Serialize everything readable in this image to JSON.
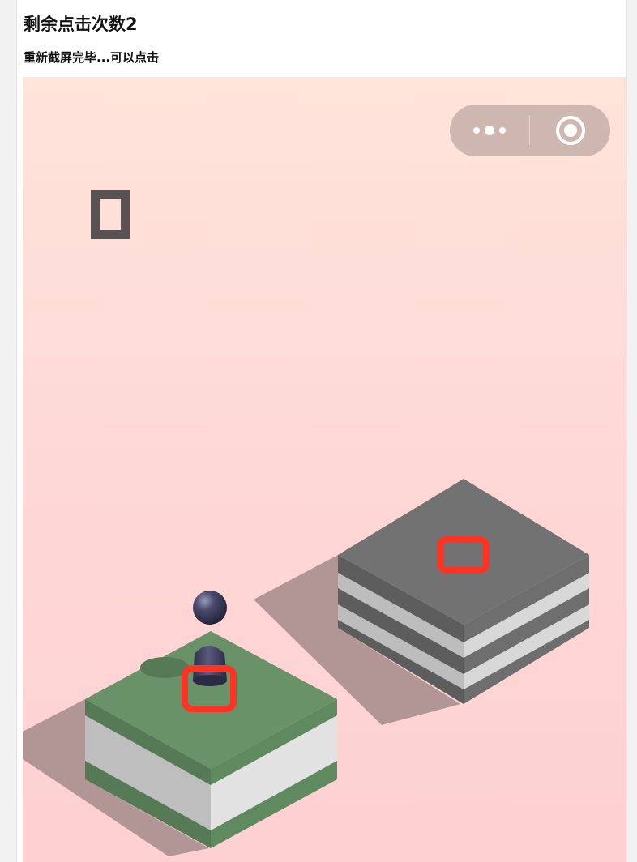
{
  "header": {
    "title": "剩余点击次数2",
    "status": "重新截屏完毕...可以点击"
  },
  "game": {
    "score": 0,
    "score_text": "0",
    "colors": {
      "background_top": "#ffe4da",
      "background_bottom": "#fdd0d2",
      "marker": "#ff3322",
      "player": "#3d3d5c",
      "current_platform_top": "#6a9268",
      "target_platform_top": "#727272"
    }
  },
  "miniprogram_capsule": {
    "more_icon": "more-dots-icon",
    "close_icon": "target-circle-icon"
  }
}
